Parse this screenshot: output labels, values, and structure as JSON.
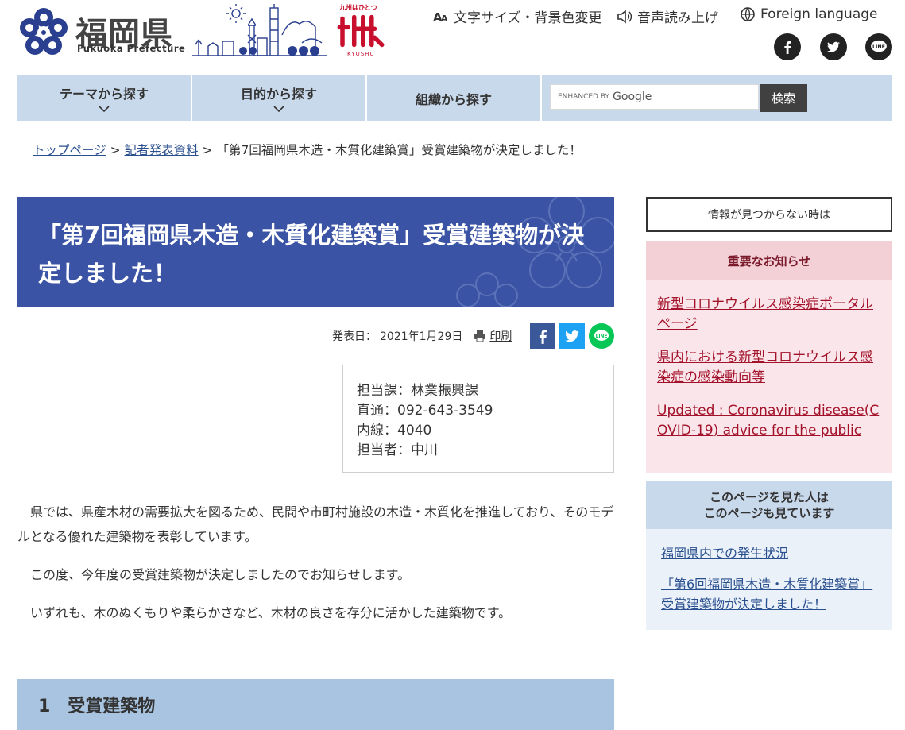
{
  "header": {
    "logo_text": "福岡県",
    "logo_sub": "Fukuoka Prefecture",
    "kyushu_tag": "九州はひとつ",
    "kyushu_label": "KYUSHU",
    "utility": {
      "text_size": "文字サイズ・背景色変更",
      "read_aloud": "音声読み上げ",
      "foreign_language": "Foreign language"
    },
    "social_icons": [
      "facebook-icon",
      "twitter-icon",
      "line-icon"
    ]
  },
  "nav": {
    "items": [
      {
        "label": "テーマから探す"
      },
      {
        "label": "目的から探す"
      },
      {
        "label": "組織から探す"
      }
    ],
    "search_prefix": "ENHANCED BY",
    "search_brand": "Google",
    "search_button": "検索"
  },
  "breadcrumb": {
    "home": "トップページ",
    "section": "記者発表資料",
    "separator": ">",
    "current": "「第7回福岡県木造・木質化建築賞」受賞建築物が決定しました！"
  },
  "article": {
    "title": "「第7回福岡県木造・木質化建築賞」受賞建築物が決定しました！",
    "date_label": "発表日：",
    "date": "2021年1月29日",
    "print_label": "印刷",
    "contact": {
      "dept": "担当課：林業振興課",
      "direct": "直通：092-643-3549",
      "extension": "内線：4040",
      "person": "担当者：中川"
    },
    "paragraphs": [
      "県では、県産木材の需要拡大を図るため、民間や市町村施設の木造・木質化を推進しており、そのモデルとなる優れた建築物を表彰しています。",
      "この度、今年度の受賞建築物が決定しましたのでお知らせします。",
      "いずれも、木のぬくもりや柔らかさなど、木材の良さを存分に活かした建築物です。"
    ],
    "section_heading": "1　受賞建築物"
  },
  "sidebar": {
    "not_found": "情報が見つからない時は",
    "important": {
      "heading": "重要なお知らせ",
      "links": [
        "新型コロナウイルス感染症ポータルページ",
        "県内における新型コロナウイルス感染症の感染動向等",
        "Updated : Coronavirus disease(COVID-19) advice for the public"
      ]
    },
    "also_viewed": {
      "heading_line1": "このページを見た人は",
      "heading_line2": "このページも見ています",
      "links": [
        "福岡県内での発生状況",
        "「第6回福岡県木造・木質化建築賞」受賞建築物が決定しました！"
      ]
    }
  },
  "colors": {
    "title_banner": "#3a53a4",
    "nav_bg": "#c9d9ec",
    "important_bg": "#fae6ea",
    "important_head": "#f3cfd6",
    "important_link": "#a3122a",
    "also_bg": "#eaf1f9",
    "section_head": "#a9c4e1",
    "facebook": "#3b5998",
    "twitter": "#1da1f2",
    "line": "#06c755"
  }
}
